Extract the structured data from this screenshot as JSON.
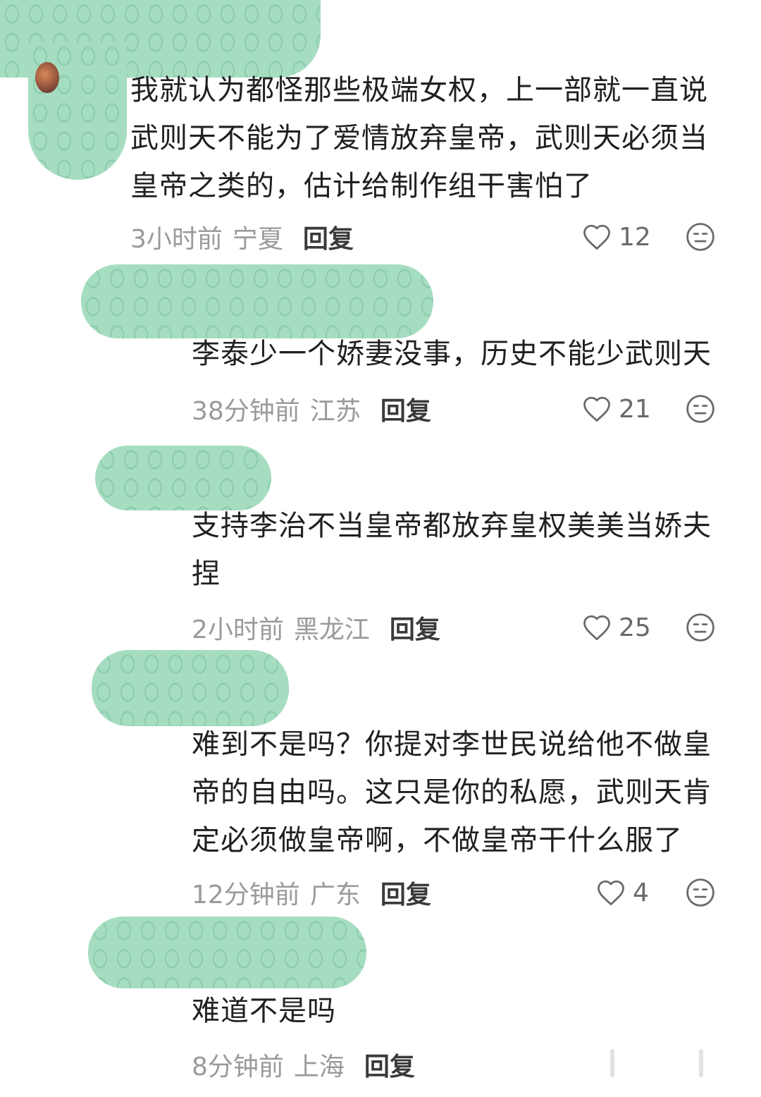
{
  "comments": [
    {
      "text": "我就认为都怪那些极端女权，上一部就一直说武则天不能为了爱情放弃皇帝，武则天必须当皇帝之类的，估计给制作组干害怕了",
      "time": "3小时前",
      "location": "宁夏",
      "reply_label": "回复",
      "likes": "12"
    },
    {
      "text": "李泰少一个娇妻没事，历史不能少武则天",
      "time": "38分钟前",
      "location": "江苏",
      "reply_label": "回复",
      "likes": "21"
    },
    {
      "text": "支持李治不当皇帝都放弃皇权美美当娇夫捏",
      "time": "2小时前",
      "location": "黑龙江",
      "reply_label": "回复",
      "likes": "25"
    },
    {
      "text": "难到不是吗？你提对李世民说给他不做皇帝的自由吗。这只是你的私愿，武则天肯定必须做皇帝啊，不做皇帝干什么服了",
      "time": "12分钟前",
      "location": "广东",
      "reply_label": "回复",
      "likes": "4"
    },
    {
      "text": "难道不是吗",
      "time": "8分钟前",
      "location": "上海",
      "reply_label": "回复"
    }
  ],
  "colors": {
    "redaction": "#a6ddc1",
    "meta_text": "#9a9a9a",
    "reply_text": "#3a3a3a"
  },
  "icons": {
    "like": "heart-outline-icon",
    "dislike": "neutral-face-icon"
  }
}
